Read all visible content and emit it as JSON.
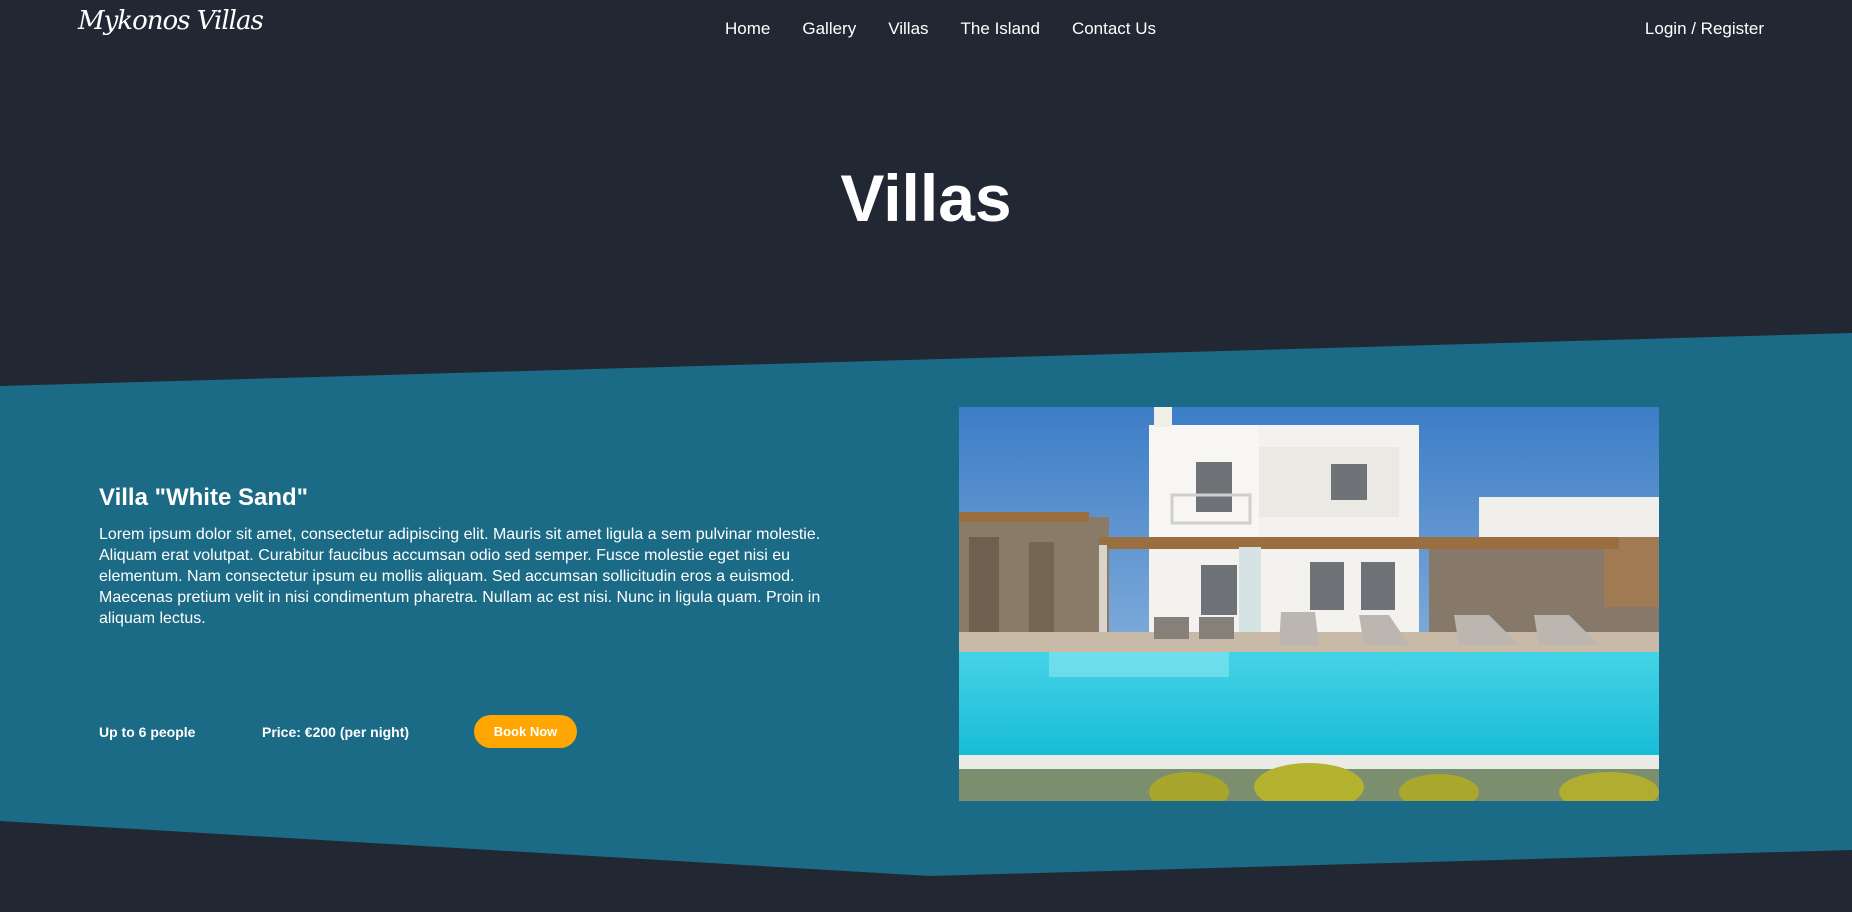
{
  "nav": {
    "logo": "Mykonos Villas",
    "links": [
      "Home",
      "Gallery",
      "Villas",
      "The Island",
      "Contact Us"
    ],
    "auth": "Login / Register"
  },
  "hero": {
    "title": "Villas"
  },
  "villa": {
    "name": "Villa \"White Sand\"",
    "description": "Lorem ipsum dolor sit amet, consectetur adipiscing elit. Mauris sit amet ligula a sem pulvinar molestie. Aliquam erat volutpat. Curabitur faucibus accumsan odio sed semper. Fusce molestie eget nisi eu elementum. Nam consectetur ipsum eu mollis aliquam. Sed accumsan sollicitudin eros a euismod. Maecenas pretium velit in nisi condimentum pharetra. Nullam ac est nisi. Nunc in ligula quam. Proin in aliquam lectus.",
    "capacity": "Up to 6 people",
    "price": "Price: €200 (per night)",
    "book_label": "Book Now"
  },
  "colors": {
    "background": "#212733",
    "band": "#1b6a86",
    "accent": "#ffa600"
  }
}
